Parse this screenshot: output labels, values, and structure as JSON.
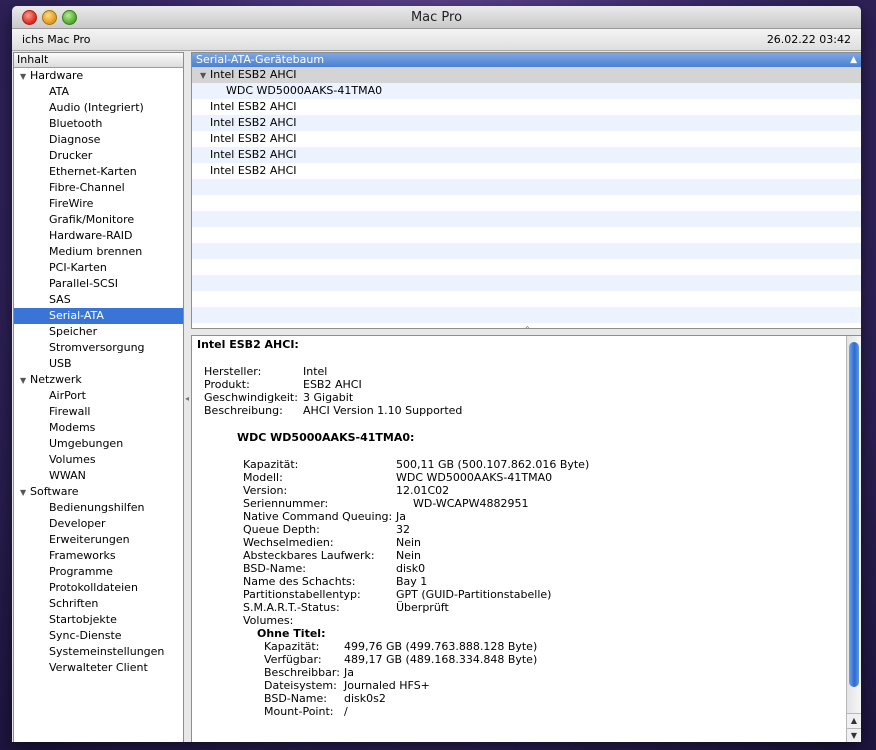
{
  "window": {
    "title": "Mac Pro"
  },
  "infobar": {
    "computer_name": "ichs Mac Pro",
    "datetime": "26.02.22 03:42"
  },
  "sidebar": {
    "header": "Inhalt",
    "categories": [
      {
        "label": "Hardware",
        "items": [
          "ATA",
          "Audio (Integriert)",
          "Bluetooth",
          "Diagnose",
          "Drucker",
          "Ethernet-Karten",
          "Fibre-Channel",
          "FireWire",
          "Grafik/Monitore",
          "Hardware-RAID",
          "Medium brennen",
          "PCI-Karten",
          "Parallel-SCSI",
          "SAS",
          "Serial-ATA",
          "Speicher",
          "Stromversorgung",
          "USB"
        ]
      },
      {
        "label": "Netzwerk",
        "items": [
          "AirPort",
          "Firewall",
          "Modems",
          "Umgebungen",
          "Volumes",
          "WWAN"
        ]
      },
      {
        "label": "Software",
        "items": [
          "Bedienungshilfen",
          "Developer",
          "Erweiterungen",
          "Frameworks",
          "Programme",
          "Protokolldateien",
          "Schriften",
          "Startobjekte",
          "Sync-Dienste",
          "Systemeinstellungen",
          "Verwalteter Client"
        ]
      }
    ],
    "selected": "Serial-ATA"
  },
  "tree": {
    "header": "Serial-ATA-Gerätebaum",
    "rows": [
      {
        "label": "Intel ESB2 AHCI",
        "level": 0,
        "expanded": true,
        "selected": true
      },
      {
        "label": "WDC WD5000AAKS-41TMA0",
        "level": 1
      },
      {
        "label": "Intel ESB2 AHCI",
        "level": 0
      },
      {
        "label": "Intel ESB2 AHCI",
        "level": 0
      },
      {
        "label": "Intel ESB2 AHCI",
        "level": 0
      },
      {
        "label": "Intel ESB2 AHCI",
        "level": 0
      },
      {
        "label": "Intel ESB2 AHCI",
        "level": 0
      }
    ]
  },
  "detail": {
    "title": "Intel ESB2 AHCI:",
    "controller": [
      {
        "label": "Hersteller:",
        "value": "Intel"
      },
      {
        "label": "Produkt:",
        "value": "ESB2 AHCI"
      },
      {
        "label": "Geschwindigkeit:",
        "value": "3 Gigabit"
      },
      {
        "label": "Beschreibung:",
        "value": "AHCI Version 1.10 Supported"
      }
    ],
    "drive_title": "WDC WD5000AAKS-41TMA0:",
    "drive": [
      {
        "label": "Kapazität:",
        "value": "500,11 GB (500.107.862.016 Byte)"
      },
      {
        "label": "Modell:",
        "value": "WDC WD5000AAKS-41TMA0"
      },
      {
        "label": "Version:",
        "value": "12.01C02"
      },
      {
        "label": "Seriennummer:",
        "value": "WD-WCAPW4882951"
      },
      {
        "label": "Native Command Queuing:",
        "value": "Ja"
      },
      {
        "label": "Queue Depth:",
        "value": "32"
      },
      {
        "label": "Wechselmedien:",
        "value": "Nein"
      },
      {
        "label": "Absteckbares Laufwerk:",
        "value": "Nein"
      },
      {
        "label": "BSD-Name:",
        "value": "disk0"
      },
      {
        "label": "Name des Schachts:",
        "value": "Bay 1"
      },
      {
        "label": "Partitionstabellentyp:",
        "value": "GPT (GUID-Partitionstabelle)"
      },
      {
        "label": "S.M.A.R.T.-Status:",
        "value": "Überprüft"
      }
    ],
    "volumes_label": "Volumes:",
    "volume_title": "Ohne Titel:",
    "volume": [
      {
        "label": "Kapazität:",
        "value": "499,76 GB (499.763.888.128 Byte)"
      },
      {
        "label": "Verfügbar:",
        "value": "489,17 GB (489.168.334.848 Byte)"
      },
      {
        "label": "Beschreibbar:",
        "value": "Ja"
      },
      {
        "label": "Dateisystem:",
        "value": "Journaled HFS+"
      },
      {
        "label": "BSD-Name:",
        "value": "disk0s2"
      },
      {
        "label": "Mount-Point:",
        "value": "/"
      }
    ]
  }
}
